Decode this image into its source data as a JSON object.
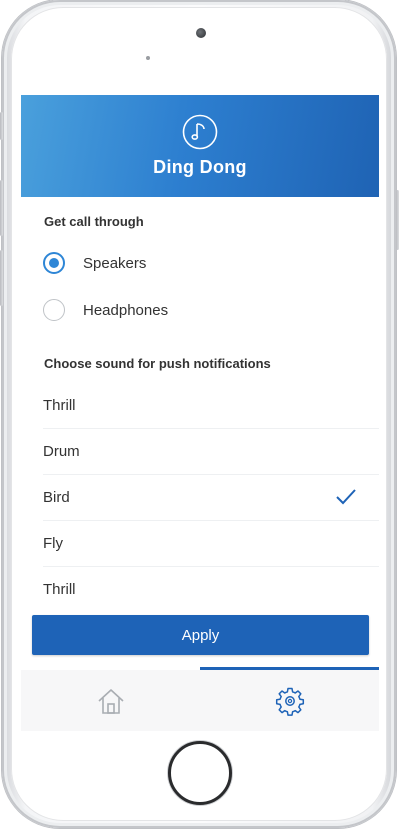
{
  "app": {
    "title": "Ding Dong",
    "logo_icon": "music-note-icon",
    "accent_color": "#1e63b7"
  },
  "call_through": {
    "title": "Get call through",
    "options": [
      {
        "label": "Speakers",
        "selected": true
      },
      {
        "label": "Headphones",
        "selected": false
      }
    ]
  },
  "notification_sound": {
    "title": "Choose sound for push notifications",
    "items": [
      {
        "label": "Thrill",
        "selected": false
      },
      {
        "label": "Drum",
        "selected": false
      },
      {
        "label": "Bird",
        "selected": true
      },
      {
        "label": "Fly",
        "selected": false
      },
      {
        "label": "Thrill",
        "selected": false
      }
    ],
    "selected_icon": "checkmark-icon"
  },
  "apply_label": "Apply",
  "tabs": [
    {
      "name": "home",
      "icon": "home-icon",
      "active": false
    },
    {
      "name": "settings",
      "icon": "gear-icon",
      "active": true
    }
  ]
}
